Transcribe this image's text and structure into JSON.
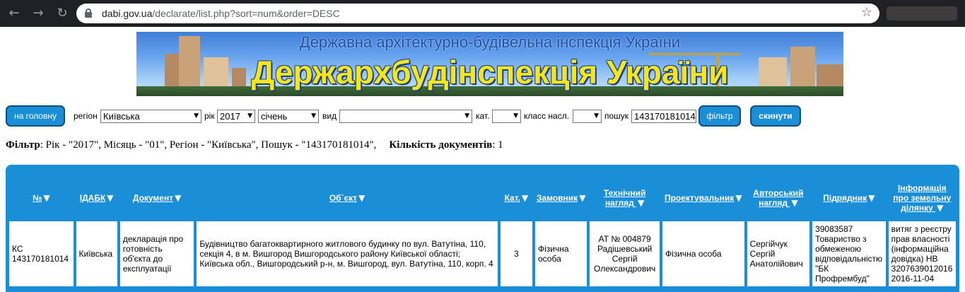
{
  "browser": {
    "nav_back": "←",
    "nav_forward": "→",
    "nav_reload": "↻",
    "url_host": "dabi.gov.ua",
    "url_path": "/declarate/list.php?sort=num&order=DESC",
    "star": "☆"
  },
  "banner": {
    "subtitle": "Державна архітектурно-будівельна інспекція України",
    "title": "Держархбудінспекція України"
  },
  "controls": {
    "home_button": "на головну",
    "region_label": "регіон",
    "region_value": "Київська",
    "year_label": "рік",
    "year_value": "2017",
    "month_value": "січень",
    "kind_label": "вид",
    "kind_value": "",
    "cat_label": "кат.",
    "cat_value": "",
    "class_label": "класс насл.",
    "class_value": "",
    "search_label": "пошук",
    "search_value": "143170181014",
    "filter_button": "фільтр",
    "reset_button": "скинути",
    "dropdown_arrow": "▼"
  },
  "filter": {
    "label": "Фільтр",
    "text": ": Рік - \"2017\", Місяць - \"01\", Регіон - \"Київська\", Пошук - \"143170181014\",",
    "count_label": "Кількість документів",
    "count_text": ": 1"
  },
  "table": {
    "sort_arrow": "▼",
    "headers": [
      "№",
      "ІДАБК",
      "Документ",
      "Об`єкт",
      "Кат.",
      "Замовник",
      "Технічний нагляд",
      "Проектувальник",
      "Авторський нагляд",
      "Підрядник",
      "Інформація про земельну ділянку"
    ],
    "rows": [
      [
        "КС 143170181014",
        "Київська",
        "декларація про готовність об'єкта до експлуатації",
        "Будівництво багатоквартирного житлового будинку по вул. Ватутіна, 110, секція 4, в м. Вишгород Вишгородського району Київської області; Київська обл., Вишгородський р-н, м. Вишгород, вул. Ватутіна, 110, корп. 4",
        "3",
        "Фізична особа",
        "АТ № 004879 Радішевський Сергій Олександрович",
        "Фізична особа",
        "Сергійчук Сергій Анатолійович",
        "39083587 Товариство з обмеженою відповідальністю \"БК Профрембуд\"",
        "витяг з реєстру прав власності (інформаційна довідка) НВ 3207639012016 2016-11-04"
      ]
    ]
  }
}
